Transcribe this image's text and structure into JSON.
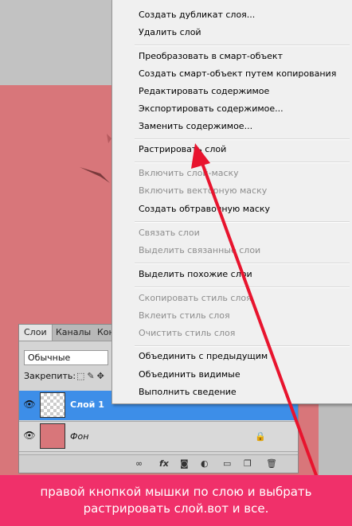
{
  "context_menu": {
    "items": [
      {
        "label": "Создать дубликат слоя...",
        "enabled": true
      },
      {
        "label": "Удалить слой",
        "enabled": true
      },
      {
        "label": "Преобразовать в смарт-объект",
        "enabled": true
      },
      {
        "label": "Создать смарт-объект путем копирования",
        "enabled": true
      },
      {
        "label": "Редактировать содержимое",
        "enabled": true
      },
      {
        "label": "Экспортировать содержимое...",
        "enabled": true
      },
      {
        "label": "Заменить содержимое...",
        "enabled": true
      },
      {
        "label": "Растрировать слой",
        "enabled": true
      },
      {
        "label": "Включить слой-маску",
        "enabled": false
      },
      {
        "label": "Включить векторную маску",
        "enabled": false
      },
      {
        "label": "Создать обтравочную маску",
        "enabled": true
      },
      {
        "label": "Связать слои",
        "enabled": false
      },
      {
        "label": "Выделить связанные слои",
        "enabled": false
      },
      {
        "label": "Выделить похожие слои",
        "enabled": true
      },
      {
        "label": "Скопировать стиль слоя",
        "enabled": false
      },
      {
        "label": "Вклеить стиль слоя",
        "enabled": false
      },
      {
        "label": "Очистить стиль слоя",
        "enabled": false
      },
      {
        "label": "Объединить с предыдущим",
        "enabled": true
      },
      {
        "label": "Объединить видимые",
        "enabled": true
      },
      {
        "label": "Выполнить сведение",
        "enabled": true
      }
    ]
  },
  "layers_panel": {
    "tabs": [
      "Слои",
      "Каналы",
      "Кон"
    ],
    "blend_mode": "Обычные",
    "lock_label": "Закрепить:",
    "layers": [
      {
        "name": "Слой 1",
        "selected": true
      },
      {
        "name": "Фон",
        "selected": false,
        "locked": true
      }
    ]
  },
  "caption": {
    "line1": "правой кнопкой мышки по слою и выбрать",
    "line2": "растрировать слой.вот и все."
  },
  "colors": {
    "canvas_pink": "#d8767a",
    "selected_layer": "#3d8ee8",
    "arrow": "#e8142e",
    "caption_bg": "#f0306a"
  }
}
